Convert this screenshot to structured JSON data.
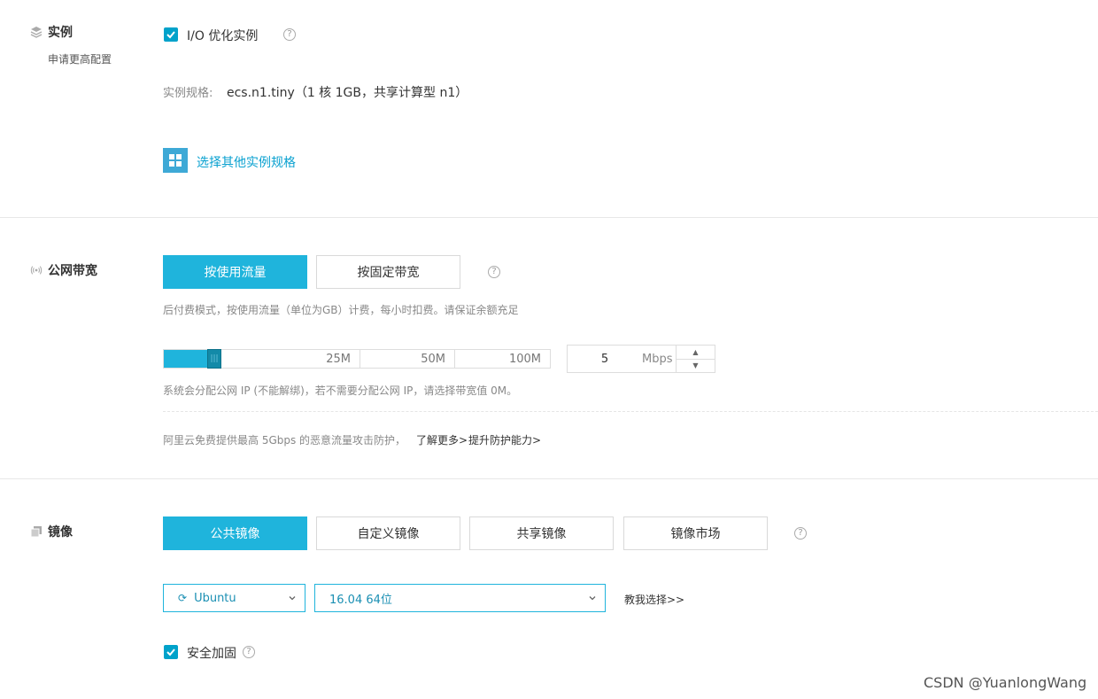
{
  "instance": {
    "title": "实例",
    "sub_label": "申请更高配置",
    "io_optimized_label": "I/O 优化实例",
    "spec_label": "实例规格:",
    "spec_value": "ecs.n1.tiny（1 核 1GB，共享计算型 n1）",
    "select_other_link": "选择其他实例规格"
  },
  "bandwidth": {
    "title": "公网带宽",
    "mode_buttons": [
      "按使用流量",
      "按固定带宽"
    ],
    "active_mode": "按使用流量",
    "mode_desc": "后付费模式，按使用流量（单位为GB）计费，每小时扣费。请保证余额充足",
    "slider_labels": [
      "25M",
      "50M",
      "100M"
    ],
    "value": "5",
    "unit": "Mbps",
    "note": "系统会分配公网 IP (不能解绑)，若不需要分配公网 IP，请选择带宽值 0M。",
    "ddos_text": "阿里云免费提供最高 5Gbps 的恶意流量攻击防护，",
    "learn_more": "了解更多>",
    "improve_protection": "提升防护能力>"
  },
  "image": {
    "title": "镜像",
    "tabs": [
      "公共镜像",
      "自定义镜像",
      "共享镜像",
      "镜像市场"
    ],
    "active_tab": "公共镜像",
    "os_select": "Ubuntu",
    "version_select": "16.04 64位",
    "help_choose": "教我选择>>",
    "security_label": "安全加固"
  },
  "watermark": "CSDN @YuanlongWang",
  "colors": {
    "accent": "#1fb4dc",
    "checkbox": "#00a2ca",
    "link": "#0aa1d0"
  }
}
